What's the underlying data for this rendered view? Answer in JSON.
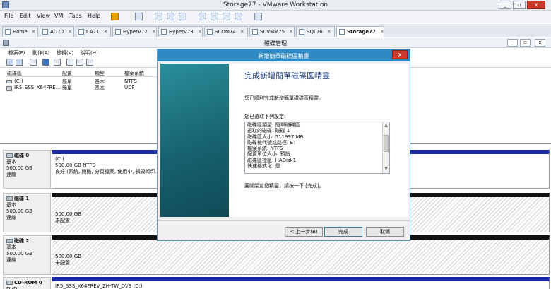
{
  "vmware": {
    "title": "Storage77 - VMware Workstation",
    "menu": [
      "File",
      "Edit",
      "View",
      "VM",
      "Tabs",
      "Help"
    ],
    "tabs": [
      "Home",
      "AD70",
      "CA71",
      "HyperV72",
      "HyperV73",
      "SCOM74",
      "SCVMM75",
      "SQL76",
      "Storage77"
    ],
    "active_tab": "Storage77",
    "window_buttons": {
      "minimize": "_",
      "restore": "▫",
      "close": "x"
    }
  },
  "guest": {
    "title": "磁碟管理",
    "menu": [
      "檔案(F)",
      "動作(A)",
      "檢視(V)",
      "說明(H)"
    ],
    "window_buttons": {
      "minimize": "_",
      "restore": "▫",
      "close": "x"
    },
    "volume_list": {
      "columns": [
        "磁碟區",
        "配置",
        "類型",
        "檔案系統"
      ],
      "rows": [
        {
          "volume": "(C:)",
          "layout": "簡單",
          "type": "基本",
          "fs": "NTFS"
        },
        {
          "volume": "IR5_SSS_X64FRE...",
          "layout": "簡單",
          "type": "基本",
          "fs": "UDF"
        }
      ]
    },
    "disks": [
      {
        "name": "磁碟 0",
        "type": "基本",
        "size": "500.00 GB",
        "status": "連線",
        "partition": {
          "label": "(C:)",
          "size": "500.00 GB NTFS",
          "status": "良好 (系統, 開機, 分頁檔案, 使用中, 損毀傾印..."
        }
      },
      {
        "name": "磁碟 1",
        "type": "基本",
        "size": "500.00 GB",
        "status": "連線",
        "partition": {
          "size": "500.00 GB",
          "status": "未配置"
        }
      },
      {
        "name": "磁碟 2",
        "type": "基本",
        "size": "500.00 GB",
        "status": "連線",
        "partition": {
          "size": "500.00 GB",
          "status": "未配置"
        }
      },
      {
        "name": "CD-ROM 0",
        "type": "DVD",
        "partition": {
          "label": "IR5_SSS_X64FREV_ZH-TW_DV9 (D:)"
        }
      }
    ]
  },
  "wizard": {
    "title": "新增簡單磁碟區精靈",
    "close": "x",
    "heading": "完成新增簡單磁碟區精靈",
    "intro": "您已順利完成新增簡單磁碟區精靈。",
    "settings_label": "您已選取下列設定:",
    "settings": [
      "磁碟區類型: 簡單磁碟區",
      "選取的磁碟: 磁碟 1",
      "磁碟區大小: 511997 MB",
      "磁碟機代號或路徑: E:",
      "檔案系統: NTFS",
      "配置單位大小: 預設",
      "磁碟區標籤: HADisk1",
      "快速格式化: 是"
    ],
    "closing_text": "要關閉這個精靈，請按一下 [完成]。",
    "buttons": {
      "back": "< 上一步(B)",
      "finish": "完成",
      "cancel": "取消"
    }
  }
}
